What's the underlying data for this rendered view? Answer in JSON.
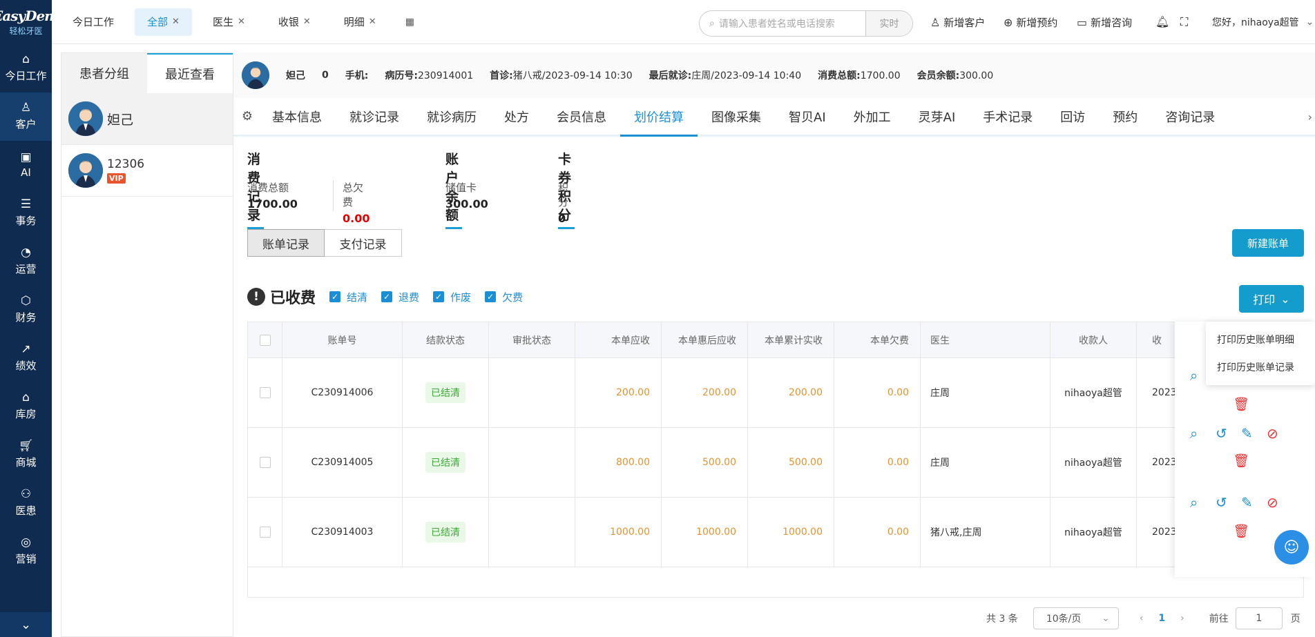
{
  "logo": {
    "main": "EasyDent",
    "sub": "轻松牙医"
  },
  "sidebar": {
    "items": [
      {
        "label": "今日工作",
        "icon": "home-icon"
      },
      {
        "label": "客户",
        "icon": "user-icon"
      },
      {
        "label": "AI",
        "icon": "ai-chip-icon"
      },
      {
        "label": "事务",
        "icon": "document-icon"
      },
      {
        "label": "运营",
        "icon": "pie-chart-icon"
      },
      {
        "label": "财务",
        "icon": "money-bag-icon"
      },
      {
        "label": "绩效",
        "icon": "trend-chart-icon"
      },
      {
        "label": "库房",
        "icon": "warehouse-icon"
      },
      {
        "label": "商城",
        "icon": "cart-icon"
      },
      {
        "label": "医患",
        "icon": "people-icon"
      },
      {
        "label": "营销",
        "icon": "target-icon"
      }
    ]
  },
  "topbar": {
    "tabs": [
      {
        "label": "今日工作",
        "closable": false
      },
      {
        "label": "全部",
        "closable": true
      },
      {
        "label": "医生",
        "closable": true
      },
      {
        "label": "收银",
        "closable": true
      },
      {
        "label": "明细",
        "closable": true
      }
    ],
    "search_placeholder": "请输入患者姓名或电话搜索",
    "search_button": "实时",
    "actions": [
      "新增客户",
      "新增预约",
      "新增咨询"
    ],
    "greeting": "您好，nihaoya超管"
  },
  "patients": {
    "tabs": [
      "患者分组",
      "最近查看"
    ],
    "list": [
      {
        "name": "妲己",
        "vip": ""
      },
      {
        "name": "12306",
        "vip": "VIP"
      }
    ]
  },
  "patient_info": {
    "name": "妲己",
    "age": "0",
    "phone_label": "手机:",
    "record_label": "病历号:",
    "record_value": "230914001",
    "first_label": "首诊:",
    "first_value": "猪八戒/2023-09-14 10:30",
    "last_label": "最后就诊:",
    "last_value": "庄周/2023-09-14 10:40",
    "total_label": "消费总额:",
    "total_value": "1700.00",
    "balance_label": "会员余额:",
    "balance_value": "300.00"
  },
  "sub_tabs": [
    "基本信息",
    "就诊记录",
    "就诊病历",
    "处方",
    "会员信息",
    "划价结算",
    "图像采集",
    "智贝AI",
    "外加工",
    "灵芽AI",
    "手术记录",
    "回访",
    "预约",
    "咨询记录"
  ],
  "summary": {
    "consume": {
      "title": "消费记录",
      "total_label": "消费总额",
      "total_value": "1700.00",
      "debt_label": "总欠费",
      "debt_value": "0.00"
    },
    "account": {
      "title": "账户余额",
      "card_label": "储值卡",
      "card_value": "300.00"
    },
    "points": {
      "title": "卡券积分",
      "label": "积分",
      "value": "0"
    }
  },
  "record_tabs": [
    "账单记录",
    "支付记录"
  ],
  "new_bill_button": "新建账单",
  "filter": {
    "title": "已收费",
    "options": [
      "结清",
      "退费",
      "作废",
      "欠费"
    ]
  },
  "print_button": "打印",
  "print_menu": [
    "打印历史账单明细",
    "打印历史账单记录"
  ],
  "table": {
    "headers": [
      "账单号",
      "结款状态",
      "审批状态",
      "本单应收",
      "本单惠后应收",
      "本单累计实收",
      "本单欠费",
      "医生",
      "收款人",
      "收"
    ],
    "rows": [
      {
        "no": "C230914006",
        "status": "已结清",
        "approval": "",
        "receivable": "200.00",
        "discounted": "200.00",
        "paid": "200.00",
        "debt": "0.00",
        "doctor": "庄周",
        "payee": "nihaoya超管",
        "date": "2023-"
      },
      {
        "no": "C230914005",
        "status": "已结清",
        "approval": "",
        "receivable": "800.00",
        "discounted": "500.00",
        "paid": "500.00",
        "debt": "0.00",
        "doctor": "庄周",
        "payee": "nihaoya超管",
        "date": "2023-"
      },
      {
        "no": "C230914003",
        "status": "已结清",
        "approval": "",
        "receivable": "1000.00",
        "discounted": "1000.00",
        "paid": "1000.00",
        "debt": "0.00",
        "doctor": "猪八戒,庄周",
        "payee": "nihaoya超管",
        "date": "2023-"
      }
    ]
  },
  "pager": {
    "total": "共 3 条",
    "size": "10条/页",
    "current": "1",
    "goto_label": "前往",
    "goto_value": "1",
    "page_suffix": "页"
  }
}
